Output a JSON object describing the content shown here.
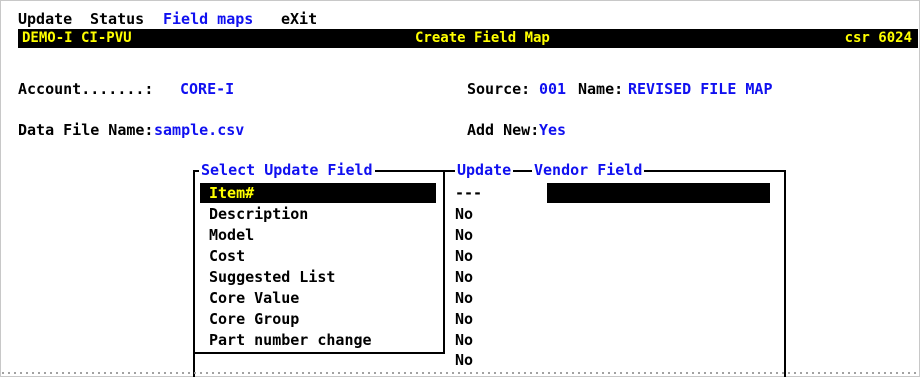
{
  "menu": {
    "items": [
      "Update",
      "Status",
      "Field maps",
      "eXit"
    ]
  },
  "title_bar": {
    "left": "DEMO-I CI-PVU",
    "center": "Create Field Map",
    "right": "csr 6024"
  },
  "header": {
    "account_label": "Account.......:",
    "account_value": "CORE-I",
    "source_label": "Source:",
    "source_value": "001",
    "name_label": "Name:",
    "name_value": "REVISED FILE MAP",
    "data_file_label": "Data File Name:",
    "data_file_value": "sample.csv",
    "add_new_label": "Add New:",
    "add_new_value": "Yes"
  },
  "box": {
    "select_title": "Select Update Field",
    "update_title": "Update",
    "vendor_title": "Vendor Field",
    "fields": [
      "Item#",
      "Description",
      "Model",
      "Cost",
      "Suggested List",
      "Core Value",
      "Core Group",
      "Part number change"
    ],
    "updates": [
      "---",
      "No",
      "No",
      "No",
      "No",
      "No",
      "No",
      "No",
      "No"
    ],
    "selected_index": 0
  },
  "colors": {
    "title_bg": "#000000",
    "title_fg": "#ffff00",
    "value_blue": "#1010f0"
  }
}
